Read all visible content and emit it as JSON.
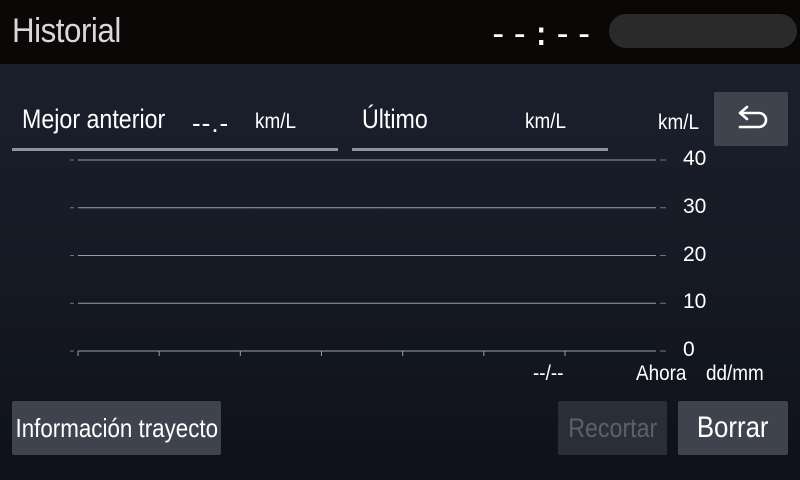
{
  "header": {
    "title": "Historial",
    "clock": "--:--"
  },
  "fields": {
    "best": {
      "label": "Mejor anterior",
      "value": "--.-",
      "unit": "km/L"
    },
    "last": {
      "label": "Último",
      "value": "",
      "unit": "km/L"
    }
  },
  "chart_data": {
    "type": "bar",
    "ylabel": "km/L",
    "ylim": [
      0,
      40
    ],
    "yticks": [
      "40",
      "30",
      "20",
      "10",
      "0"
    ],
    "categories": [],
    "values": [],
    "x_date_placeholder": "--/--",
    "x_now_label": "Ahora",
    "x_unit": "dd/mm",
    "grid": true
  },
  "buttons": {
    "back_icon": "back-arrow-icon",
    "trip_info": "Información trayecto",
    "trim": "Recortar",
    "clear": "Borrar"
  },
  "colors": {
    "header_bg": "#0b0707",
    "button_bg": "#3e434d",
    "button_disabled_text": "#5c6069",
    "underline": "#8f939a"
  }
}
